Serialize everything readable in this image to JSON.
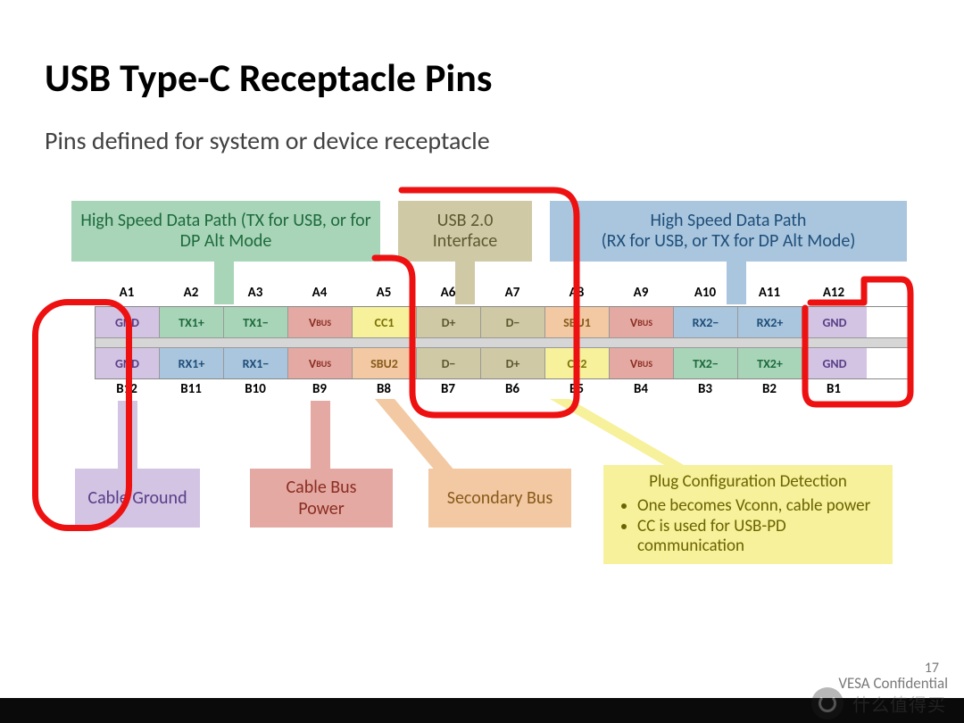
{
  "title": "USB Type-C Receptacle Pins",
  "subtitle": "Pins defined for system or device receptacle",
  "legend_top": {
    "left": "High Speed Data Path (TX for USB, or for DP Alt Mode",
    "mid": "USB 2.0 Interface",
    "right": "High Speed Data Path\n(RX for USB, or TX for DP Alt Mode)"
  },
  "rowA_labels": [
    "A1",
    "A2",
    "A3",
    "A4",
    "A5",
    "A6",
    "A7",
    "A8",
    "A9",
    "A10",
    "A11",
    "A12"
  ],
  "rowA_pins": [
    {
      "t": "GND",
      "c": "c-gnd"
    },
    {
      "t": "TX1+",
      "c": "c-txg"
    },
    {
      "t": "TX1−",
      "c": "c-txg"
    },
    {
      "t": "VBUS",
      "c": "c-vbus",
      "sub": true
    },
    {
      "t": "CC1",
      "c": "c-ccy"
    },
    {
      "t": "D+",
      "c": "c-dtan"
    },
    {
      "t": "D−",
      "c": "c-dtan"
    },
    {
      "t": "SBU1",
      "c": "c-sbu"
    },
    {
      "t": "VBUS",
      "c": "c-vbus",
      "sub": true
    },
    {
      "t": "RX2−",
      "c": "c-rxb"
    },
    {
      "t": "RX2+",
      "c": "c-rxb"
    },
    {
      "t": "GND",
      "c": "c-gnd"
    }
  ],
  "rowB_labels": [
    "B12",
    "B11",
    "B10",
    "B9",
    "B8",
    "B7",
    "B6",
    "B5",
    "B4",
    "B3",
    "B2",
    "B1"
  ],
  "rowB_pins": [
    {
      "t": "GND",
      "c": "c-gnd"
    },
    {
      "t": "RX1+",
      "c": "c-rxb"
    },
    {
      "t": "RX1−",
      "c": "c-rxb"
    },
    {
      "t": "VBUS",
      "c": "c-vbus",
      "sub": true
    },
    {
      "t": "SBU2",
      "c": "c-sbu"
    },
    {
      "t": "D−",
      "c": "c-dtan"
    },
    {
      "t": "D+",
      "c": "c-dtan"
    },
    {
      "t": "CC2",
      "c": "c-ccy"
    },
    {
      "t": "VBUS",
      "c": "c-vbus",
      "sub": true
    },
    {
      "t": "TX2−",
      "c": "c-txg"
    },
    {
      "t": "TX2+",
      "c": "c-txg"
    },
    {
      "t": "GND",
      "c": "c-gnd"
    }
  ],
  "legend_bottom": {
    "ground": "Cable Ground",
    "buspower": "Cable Bus Power",
    "secbus": "Secondary Bus",
    "plugcfg_title": "Plug Configuration Detection",
    "plugcfg_items": [
      "One becomes Vconn, cable power",
      "CC is used for USB-PD communication"
    ]
  },
  "footer": {
    "page": "17",
    "confidential": "VESA Confidential",
    "watermark_text": "什么值得买"
  }
}
